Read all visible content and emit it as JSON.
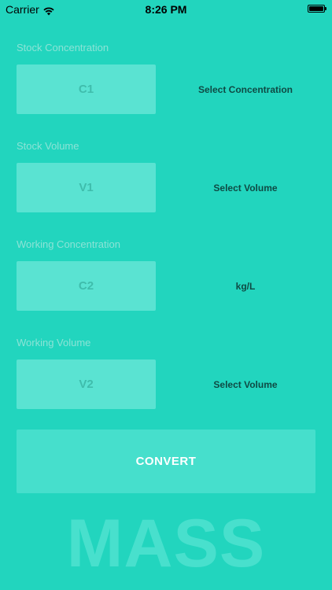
{
  "status_bar": {
    "carrier": "Carrier",
    "time": "8:26 PM"
  },
  "fields": [
    {
      "label": "Stock Concentration",
      "placeholder": "C1",
      "unit": "Select Concentration"
    },
    {
      "label": "Stock Volume",
      "placeholder": "V1",
      "unit": "Select Volume"
    },
    {
      "label": "Working Concentration",
      "placeholder": "C2",
      "unit": "kg/L"
    },
    {
      "label": "Working Volume",
      "placeholder": "V2",
      "unit": "Select Volume"
    }
  ],
  "convert_label": "CONVERT",
  "mode_title": "MASS",
  "colors": {
    "background": "#22D5BE",
    "field": "#5AE3D2",
    "button": "#46DFCC"
  }
}
